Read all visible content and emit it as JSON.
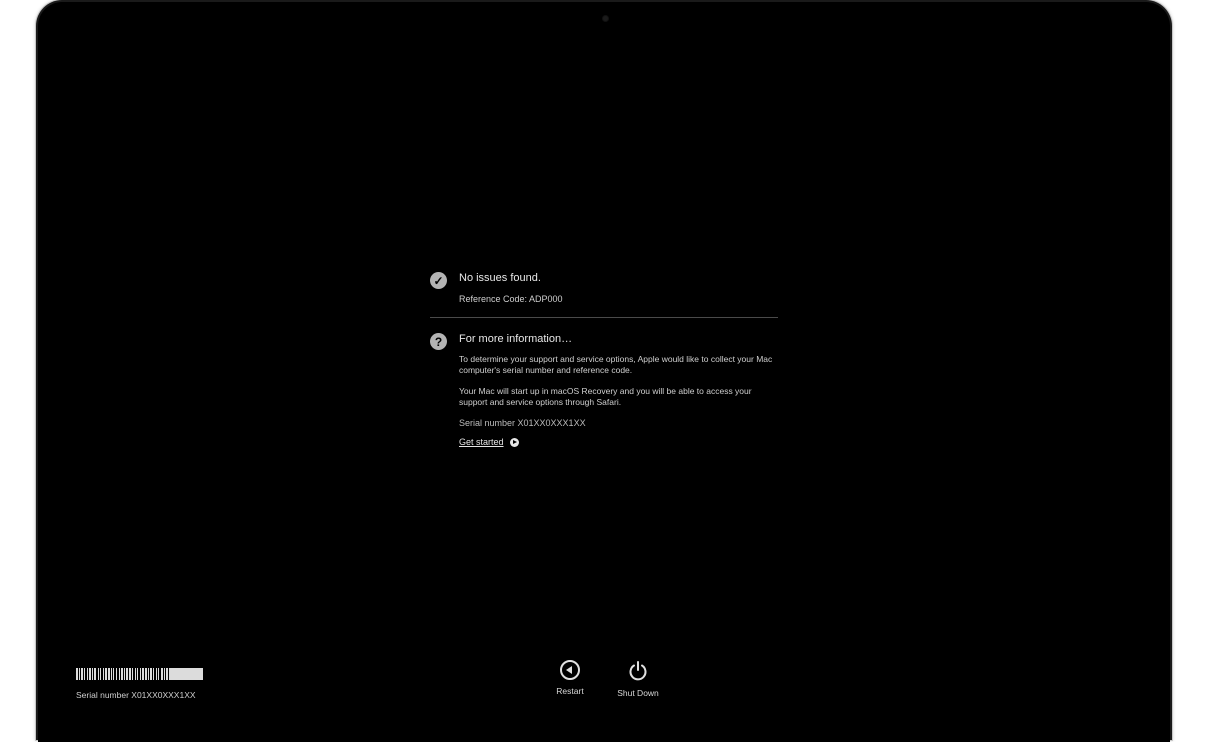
{
  "status": {
    "icon": "checkmark-circle-icon",
    "title": "No issues found.",
    "reference_code": "Reference Code: ADP000"
  },
  "info": {
    "icon": "question-circle-icon",
    "title": "For more information…",
    "paragraph1": "To determine your support and service options, Apple would like to collect your Mac computer's serial number and reference code.",
    "paragraph2": "Your Mac will start up in macOS Recovery and you will be able to access your support and service options through Safari.",
    "serial": "Serial number X01XX0XXX1XX",
    "link_label": "Get started",
    "link_icon": "arrow-right-circle-icon"
  },
  "footer": {
    "barcode_icon": "barcode-icon",
    "serial": "Serial number X01XX0XXX1XX",
    "restart_label": "Restart",
    "restart_icon": "restart-icon",
    "shutdown_label": "Shut Down",
    "shutdown_icon": "power-icon"
  },
  "colors": {
    "screen_background": "#000000",
    "text_primary": "#e6e6e6",
    "text_secondary": "#cfcfcf",
    "icon_fill": "#b3b3b3"
  }
}
